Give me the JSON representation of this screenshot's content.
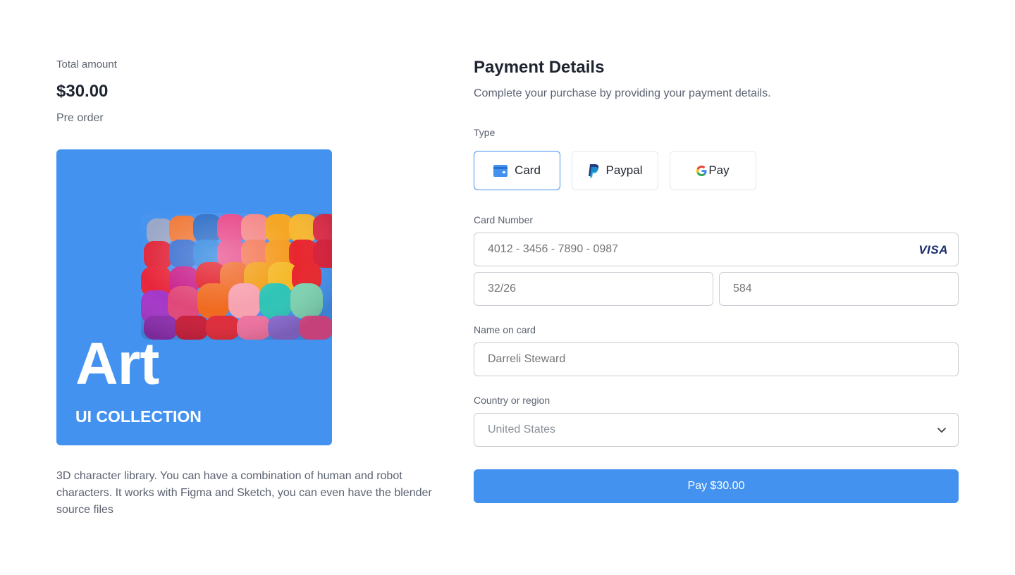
{
  "summary": {
    "total_label": "Total amount",
    "total_amount": "$30.00",
    "pre_order": "Pre order",
    "card_title": "Art",
    "card_subtitle": "UI COLLECTION",
    "description": "3D character library. You can have a combination of human and robot characters. It works with Figma and Sketch, you can even have the blender source files"
  },
  "payment": {
    "title": "Payment Details",
    "subtitle": "Complete your purchase by providing your payment details.",
    "type_label": "Type",
    "types": [
      {
        "label": "Card",
        "icon": "wallet-icon",
        "selected": true
      },
      {
        "label": "Paypal",
        "icon": "paypal-icon",
        "selected": false
      },
      {
        "label": "Pay",
        "icon": "google-g-icon",
        "selected": false
      }
    ],
    "card_number_label": "Card Number",
    "card_number_placeholder": "4012 - 3456 - 7890 - 0987",
    "card_brand": "VISA",
    "expiry_placeholder": "32/26",
    "cvc_placeholder": "584",
    "name_label": "Name on card",
    "name_placeholder": "Darreli Steward",
    "country_label": "Country or region",
    "country_value": "United States",
    "pay_button": "Pay $30.00"
  },
  "colors": {
    "accent": "#4492f0",
    "card_bg": "#4492f0",
    "visa": "#1a2b6e"
  }
}
